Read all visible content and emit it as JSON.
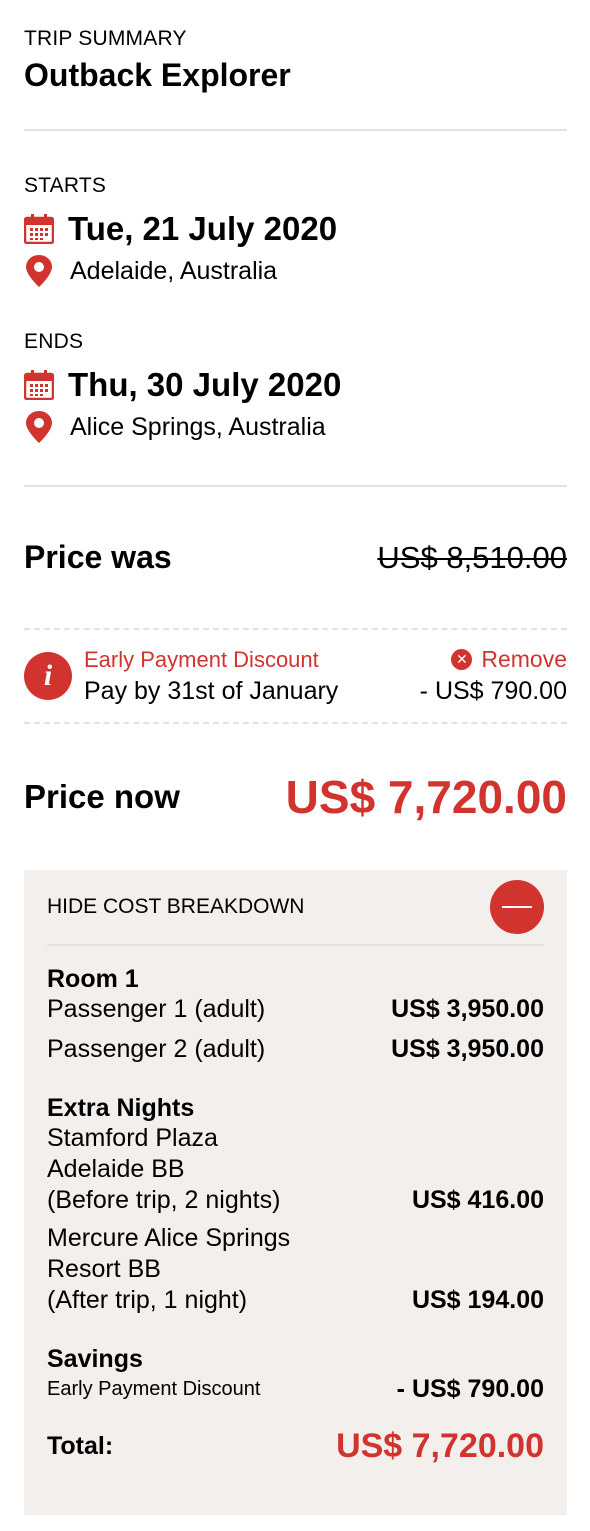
{
  "trip": {
    "eyebrow": "TRIP SUMMARY",
    "title": "Outback Explorer"
  },
  "starts": {
    "label": "STARTS",
    "date": "Tue, 21 July 2020",
    "location": "Adelaide, Australia"
  },
  "ends": {
    "label": "ENDS",
    "date": "Thu, 30 July 2020",
    "location": "Alice Springs, Australia"
  },
  "price_was": {
    "label": "Price was",
    "value": "US$ 8,510.00"
  },
  "discount": {
    "title": "Early Payment Discount",
    "subtitle": "Pay by 31st of January",
    "remove_label": "Remove",
    "amount": "- US$ 790.00"
  },
  "price_now": {
    "label": "Price now",
    "value": "US$ 7,720.00"
  },
  "breakdown": {
    "toggle_label": "HIDE COST BREAKDOWN",
    "room": {
      "title": "Room 1",
      "passengers": [
        {
          "label": "Passenger 1 (adult)",
          "amount": "US$ 3,950.00"
        },
        {
          "label": "Passenger 2 (adult)",
          "amount": "US$ 3,950.00"
        }
      ]
    },
    "extra_nights": {
      "title": "Extra Nights",
      "items": [
        {
          "line1": "Stamford Plaza",
          "line2": "Adelaide BB",
          "line3": "(Before trip, 2 nights)",
          "amount": "US$ 416.00"
        },
        {
          "line1": "Mercure Alice Springs",
          "line2": "Resort BB",
          "line3": "(After trip, 1 night)",
          "amount": "US$ 194.00"
        }
      ]
    },
    "savings": {
      "title": "Savings",
      "label": "Early Payment Discount",
      "amount": "- US$ 790.00"
    },
    "total": {
      "label": "Total:",
      "amount": "US$ 7,720.00"
    }
  },
  "colors": {
    "accent": "#d1332f",
    "breakdown_bg": "#f3efec",
    "divider": "#e2e2e2"
  },
  "icons": {
    "calendar": "calendar-icon",
    "pin": "map-pin-icon",
    "info": "info-icon",
    "remove": "close-circle-icon",
    "collapse": "minus-icon"
  }
}
